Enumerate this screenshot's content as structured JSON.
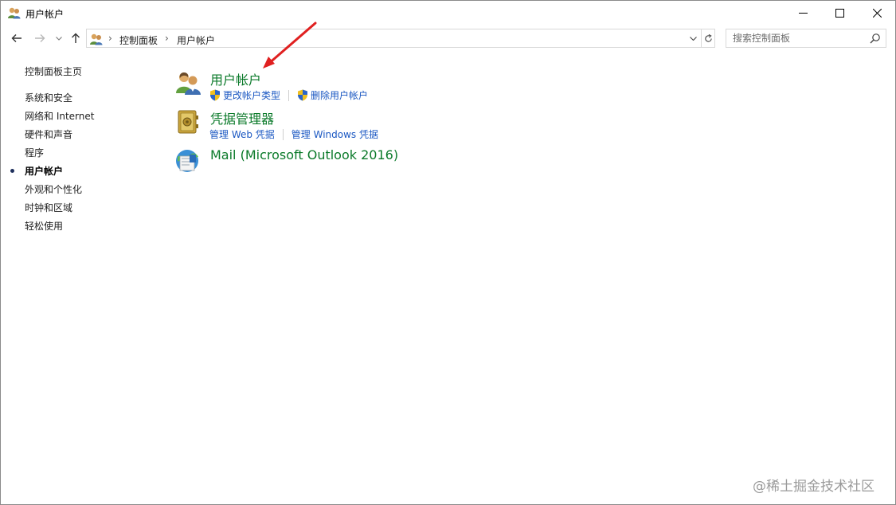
{
  "window": {
    "title": "用户帐户",
    "icon": "users-icon"
  },
  "navigation": {
    "back_icon": "arrow-left-icon",
    "forward_icon": "arrow-right-icon",
    "recent_icon": "chevron-down-icon",
    "up_icon": "arrow-up-icon"
  },
  "address": {
    "breadcrumbs": [
      "控制面板",
      "用户帐户"
    ],
    "separator": "›"
  },
  "search": {
    "placeholder": "搜索控制面板"
  },
  "sidebar": {
    "home": "控制面板主页",
    "items": [
      {
        "label": "系统和安全",
        "active": false
      },
      {
        "label": "网络和 Internet",
        "active": false
      },
      {
        "label": "硬件和声音",
        "active": false
      },
      {
        "label": "程序",
        "active": false
      },
      {
        "label": "用户帐户",
        "active": true
      },
      {
        "label": "外观和个性化",
        "active": false
      },
      {
        "label": "时钟和区域",
        "active": false
      },
      {
        "label": "轻松使用",
        "active": false
      }
    ]
  },
  "main": {
    "entries": [
      {
        "title": "用户帐户",
        "icon": "users-icon",
        "links": [
          {
            "label": "更改帐户类型",
            "shield": true
          },
          {
            "label": "删除用户帐户",
            "shield": true
          }
        ]
      },
      {
        "title": "凭据管理器",
        "icon": "credential-vault-icon",
        "links": [
          {
            "label": "管理 Web 凭据",
            "shield": false
          },
          {
            "label": "管理 Windows 凭据",
            "shield": false
          }
        ]
      },
      {
        "title": "Mail (Microsoft Outlook 2016)",
        "icon": "mail-icon",
        "links": []
      }
    ]
  },
  "annotation": {
    "color": "#e02020"
  },
  "watermark": "@稀土掘金技术社区"
}
